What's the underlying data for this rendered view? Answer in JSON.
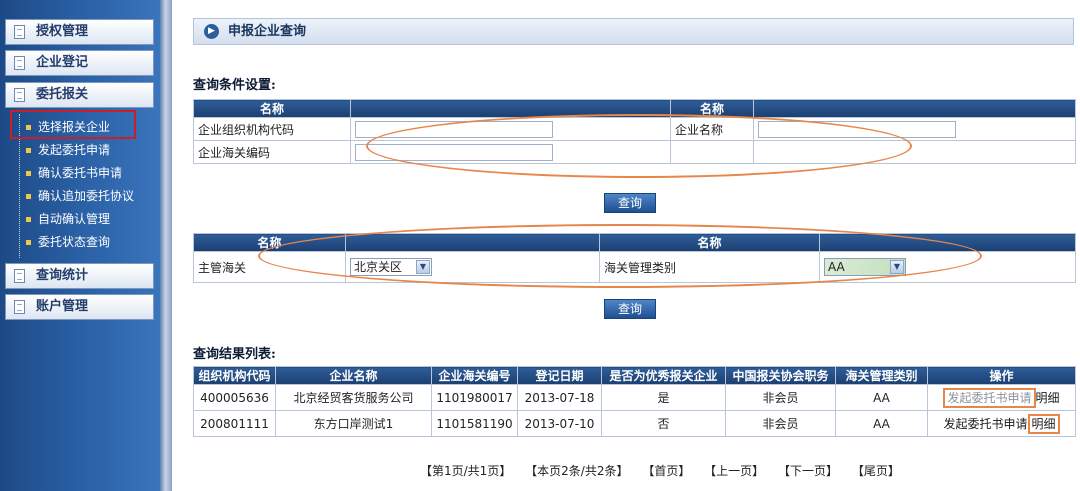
{
  "sidebar": {
    "heads": [
      "授权管理",
      "企业登记",
      "委托报关",
      "查询统计",
      "账户管理"
    ],
    "sub_items": [
      "选择报关企业",
      "发起委托申请",
      "确认委托书申请",
      "确认追加委托协议",
      "自动确认管理",
      "委托状态查询"
    ]
  },
  "page_title": "申报企业查询",
  "query_section_label": "查询条件设置:",
  "query1": {
    "header_name_1": "名称",
    "header_name_2": "名称",
    "org_code_label": "企业组织机构代码",
    "enterprise_name_label": "企业名称",
    "customs_code_label": "企业海关编码",
    "query_button": "查询"
  },
  "query2": {
    "header_name_1": "名称",
    "header_name_2": "名称",
    "customs_label": "主管海关",
    "customs_value": "北京关区",
    "mgmt_label": "海关管理类别",
    "mgmt_value": "AA",
    "query_button": "查询"
  },
  "results_label": "查询结果列表:",
  "results": {
    "columns": [
      "组织机构代码",
      "企业名称",
      "企业海关编号",
      "登记日期",
      "是否为优秀报关企业",
      "中国报关协会职务",
      "海关管理类别",
      "操作"
    ],
    "rows": [
      {
        "org": "400005636",
        "name": "北京经贸客货服务公司",
        "code": "1101980017",
        "date": "2013-07-18",
        "excellent": "是",
        "role": "非会员",
        "category": "AA",
        "action": "发起委托书申请",
        "detail": "明细"
      },
      {
        "org": "200801111",
        "name": "东方口岸测试1",
        "code": "1101581190",
        "date": "2013-07-10",
        "excellent": "否",
        "role": "非会员",
        "category": "AA",
        "action": "发起委托书申请",
        "detail": "明细"
      }
    ]
  },
  "pager": [
    "【第1页/共1页】",
    "【本页2条/共2条】",
    "【首页】",
    "【上一页】",
    "【下一页】",
    "【尾页】"
  ],
  "colors": {
    "highlight_red": "#c8202a",
    "annotation_orange": "#e8864a",
    "header_blue": "#1b3f72"
  }
}
